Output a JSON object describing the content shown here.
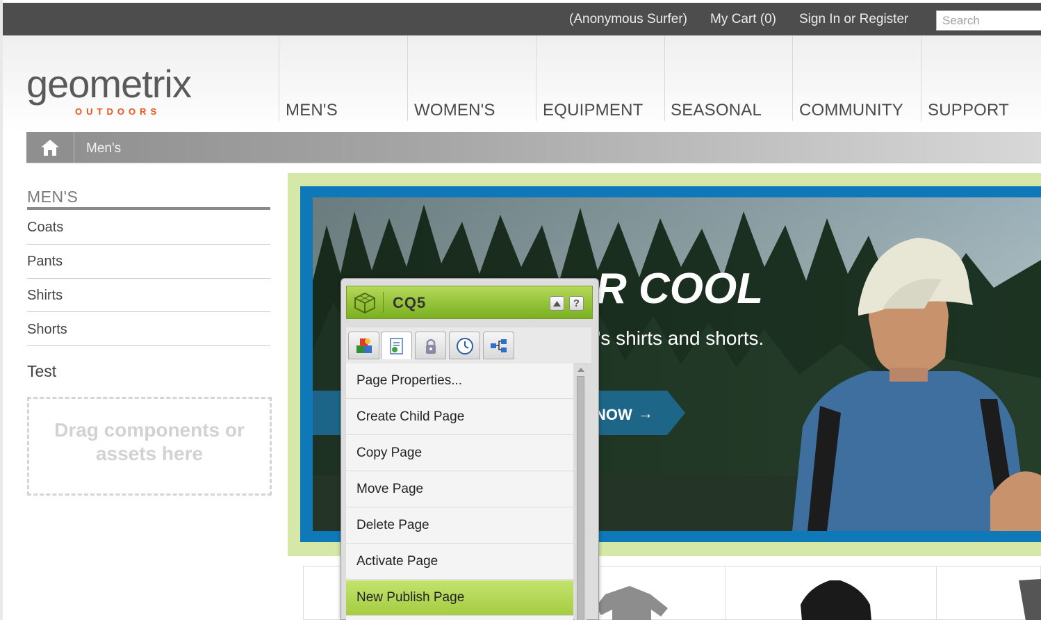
{
  "topbar": {
    "user": "(Anonymous Surfer)",
    "cart": "My Cart (0)",
    "signin": "Sign In or Register",
    "search_placeholder": "Search"
  },
  "logo": {
    "wordmark": "geometrix",
    "sub": "OUTDOORS"
  },
  "nav": [
    "MEN'S",
    "WOMEN'S",
    "EQUIPMENT",
    "SEASONAL",
    "COMMUNITY",
    "SUPPORT"
  ],
  "breadcrumb": {
    "current": "Men's"
  },
  "sidebar": {
    "title": "MEN'S",
    "items": [
      "Coats",
      "Pants",
      "Shirts",
      "Shorts"
    ],
    "extra": "Test",
    "dropzone": "Drag components or assets here"
  },
  "hero": {
    "headline_visible": "R COOL",
    "subline_visible": "'s shirts and shorts.",
    "cta_visible": "NOW"
  },
  "sidekick": {
    "title": "CQ5",
    "items": [
      "Page Properties...",
      "Create Child Page",
      "Copy Page",
      "Move Page",
      "Delete Page",
      "Activate Page",
      "New Publish Page"
    ],
    "selected": "New Publish Page",
    "tabs": [
      "components-tab-icon",
      "page-tab-icon",
      "lock-tab-icon",
      "versioning-tab-icon",
      "workflow-tab-icon"
    ]
  },
  "colors": {
    "topbar": "#4d4d4d",
    "accent_orange": "#e8521c",
    "hero_frame_green": "#d6e8a8",
    "hero_frame_blue": "#0f78b8",
    "sidekick_green": "#8cc02e"
  }
}
